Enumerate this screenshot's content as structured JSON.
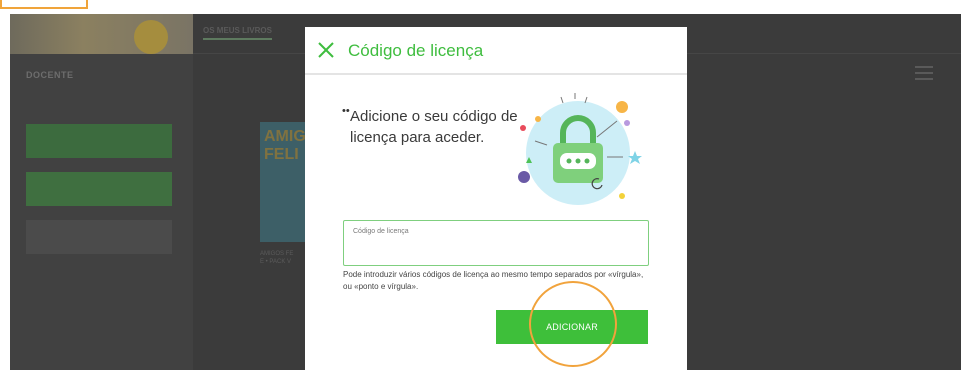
{
  "background": {
    "tab_label": "OS MEUS LIVROS",
    "role_label": "DOCENTE",
    "nav_buttons": [
      "",
      "",
      ""
    ],
    "book_cover_title": "AMIG\nFELI",
    "book_caption": "AMIGOS FE\nE • PACK V"
  },
  "modal": {
    "title": "Código de licença",
    "intro_text": "Adicione o seu código de licença para aceder.",
    "field_label": "Código de licença",
    "field_value": "",
    "hint": "Pode introduzir vários códigos de licença ao mesmo tempo separados por «vírgula», ou «ponto e vírgula».",
    "add_button_label": "ADICIONAR"
  },
  "colors": {
    "accent_green": "#3ebf3a",
    "highlight_orange": "#f1a33c",
    "overlay": "#3b3b3b"
  },
  "icons": {
    "close": "close-icon",
    "illustration": "padlock-illustration",
    "list_view": "list-view-icon"
  }
}
